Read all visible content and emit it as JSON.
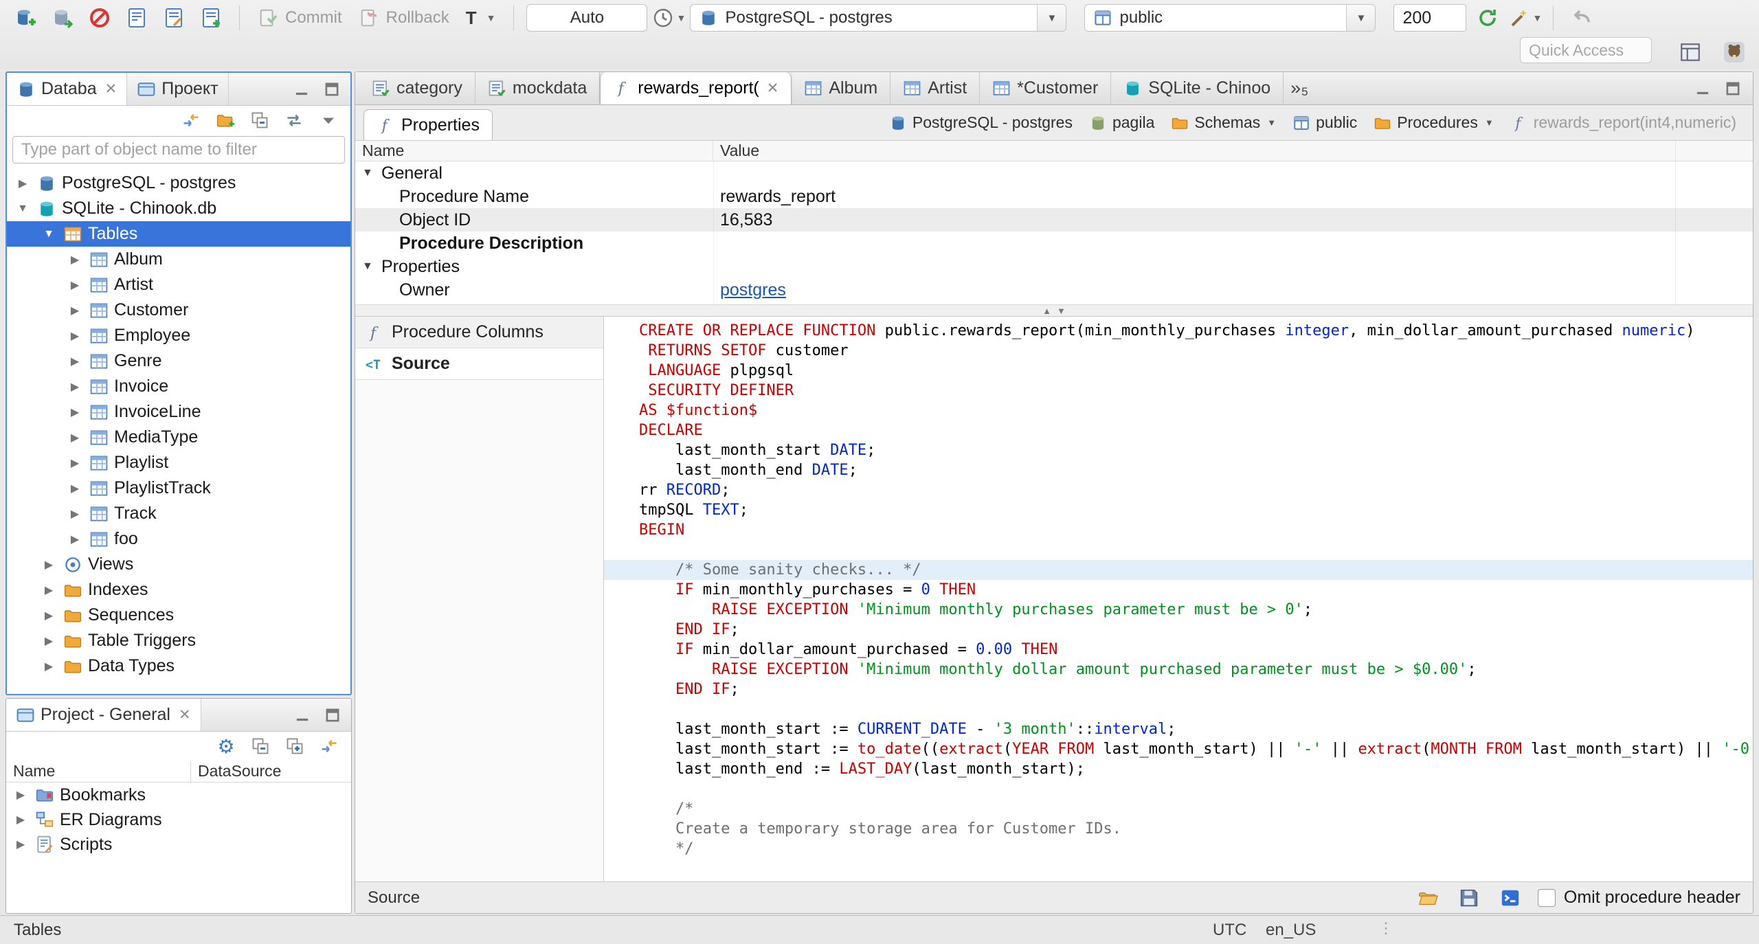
{
  "colors": {
    "selection_blue": "#3874d9",
    "focus_border": "#4f8fdb",
    "syntax_keyword": "#c80000",
    "syntax_type": "#0026d0",
    "syntax_string": "#00911f",
    "syntax_comment": "#6f6f6f",
    "link_blue": "#1a56b0"
  },
  "toolbar": {
    "commit_label": "Commit",
    "rollback_label": "Rollback",
    "txn_mode_label": "T",
    "auto_label": "Auto",
    "connection_value": "PostgreSQL - postgres",
    "schema_value": "public",
    "fetch_size": "200",
    "quick_access_placeholder": "Quick Access"
  },
  "navigator": {
    "tabs": [
      {
        "label": "Databa"
      },
      {
        "label": "Проект"
      }
    ],
    "filter_placeholder": "Type part of object name to filter",
    "tree": [
      {
        "label": "PostgreSQL - postgres",
        "icon": "postgres-icon",
        "level": 0,
        "state": "collapsed"
      },
      {
        "label": "SQLite - Chinook.db",
        "icon": "sqlite-icon",
        "level": 0,
        "state": "expanded"
      },
      {
        "label": "Tables",
        "icon": "tables-icon",
        "level": 1,
        "state": "expanded",
        "selected": true
      },
      {
        "label": "Album",
        "icon": "table-icon",
        "level": 2,
        "state": "collapsed"
      },
      {
        "label": "Artist",
        "icon": "table-icon",
        "level": 2,
        "state": "collapsed"
      },
      {
        "label": "Customer",
        "icon": "table-icon",
        "level": 2,
        "state": "collapsed"
      },
      {
        "label": "Employee",
        "icon": "table-icon",
        "level": 2,
        "state": "collapsed"
      },
      {
        "label": "Genre",
        "icon": "table-icon",
        "level": 2,
        "state": "collapsed"
      },
      {
        "label": "Invoice",
        "icon": "table-icon",
        "level": 2,
        "state": "collapsed"
      },
      {
        "label": "InvoiceLine",
        "icon": "table-icon",
        "level": 2,
        "state": "collapsed"
      },
      {
        "label": "MediaType",
        "icon": "table-icon",
        "level": 2,
        "state": "collapsed"
      },
      {
        "label": "Playlist",
        "icon": "table-icon",
        "level": 2,
        "state": "collapsed"
      },
      {
        "label": "PlaylistTrack",
        "icon": "table-icon",
        "level": 2,
        "state": "collapsed"
      },
      {
        "label": "Track",
        "icon": "table-icon",
        "level": 2,
        "state": "collapsed"
      },
      {
        "label": "foo",
        "icon": "table-icon",
        "level": 2,
        "state": "collapsed"
      },
      {
        "label": "Views",
        "icon": "views-icon",
        "level": 1,
        "state": "collapsed"
      },
      {
        "label": "Indexes",
        "icon": "folder-icon",
        "level": 1,
        "state": "collapsed"
      },
      {
        "label": "Sequences",
        "icon": "folder-icon",
        "level": 1,
        "state": "collapsed"
      },
      {
        "label": "Table Triggers",
        "icon": "folder-icon",
        "level": 1,
        "state": "collapsed"
      },
      {
        "label": "Data Types",
        "icon": "folder-icon",
        "level": 1,
        "state": "collapsed"
      }
    ]
  },
  "project_panel": {
    "tab_label": "Project - General",
    "columns": [
      "Name",
      "DataSource"
    ],
    "items": [
      {
        "label": "Bookmarks",
        "icon": "bookmarks-icon"
      },
      {
        "label": "ER Diagrams",
        "icon": "er-diagram-icon"
      },
      {
        "label": "Scripts",
        "icon": "scripts-icon"
      }
    ]
  },
  "editor_tabs": [
    {
      "label": "category",
      "icon": "script-icon"
    },
    {
      "label": "mockdata",
      "icon": "script-icon"
    },
    {
      "label": "rewards_report(",
      "icon": "function-icon",
      "active": true,
      "closable": true
    },
    {
      "label": "Album",
      "icon": "table-icon"
    },
    {
      "label": "Artist",
      "icon": "table-icon"
    },
    {
      "label": "*Customer",
      "icon": "table-icon"
    },
    {
      "label": "SQLite - Chinoo",
      "icon": "sqlite-icon"
    }
  ],
  "tab_overflow_count": "5",
  "properties_view": {
    "tab_label": "Properties",
    "columns": [
      "Name",
      "Value"
    ],
    "breadcrumb": [
      {
        "label": "PostgreSQL - postgres",
        "icon": "postgres-icon"
      },
      {
        "label": "pagila",
        "icon": "database-icon"
      },
      {
        "label": "Schemas",
        "icon": "folder-icon",
        "dropdown": true
      },
      {
        "label": "public",
        "icon": "schema-icon"
      },
      {
        "label": "Procedures",
        "icon": "folder-icon",
        "dropdown": true
      },
      {
        "label": "rewards_report(int4,numeric)",
        "icon": "function-icon",
        "muted": true
      }
    ],
    "rows": [
      {
        "type": "group",
        "name": "General"
      },
      {
        "type": "prop",
        "name": "Procedure Name",
        "value": "rewards_report"
      },
      {
        "type": "prop",
        "name": "Object ID",
        "value": "16,583",
        "shaded": true
      },
      {
        "type": "prop",
        "name": "Procedure Description",
        "value": "",
        "bold": true
      },
      {
        "type": "group",
        "name": "Properties"
      },
      {
        "type": "prop",
        "name": "Owner",
        "value": "postgres",
        "link": true
      }
    ]
  },
  "source_view": {
    "tabs": [
      {
        "label": "Procedure Columns",
        "icon": "function-icon"
      },
      {
        "label": "Source",
        "icon": "source-icon",
        "active": true
      }
    ],
    "bottom_label": "Source",
    "omit_label": "Omit procedure header",
    "code_lines": [
      {
        "h": false,
        "seg": [
          [
            "k",
            "CREATE OR REPLACE FUNCTION "
          ],
          [
            "p",
            "public.rewards_report(min_monthly_purchases "
          ],
          [
            "t",
            "integer"
          ],
          [
            "p",
            ", min_dollar_amount_purchased "
          ],
          [
            "t",
            "numeric"
          ],
          [
            "p",
            ")"
          ]
        ]
      },
      {
        "h": false,
        "seg": [
          [
            "p",
            " "
          ],
          [
            "k",
            "RETURNS SETOF"
          ],
          [
            "p",
            " customer"
          ]
        ]
      },
      {
        "h": false,
        "seg": [
          [
            "p",
            " "
          ],
          [
            "k",
            "LANGUAGE"
          ],
          [
            "p",
            " plpgsql"
          ]
        ]
      },
      {
        "h": false,
        "seg": [
          [
            "p",
            " "
          ],
          [
            "k",
            "SECURITY DEFINER"
          ]
        ]
      },
      {
        "h": false,
        "seg": [
          [
            "k",
            "AS"
          ],
          [
            "p",
            " "
          ],
          [
            "k",
            "$function$"
          ]
        ]
      },
      {
        "h": false,
        "seg": [
          [
            "k",
            "DECLARE"
          ]
        ]
      },
      {
        "h": false,
        "seg": [
          [
            "p",
            "    last_month_start "
          ],
          [
            "t",
            "DATE"
          ],
          [
            "p",
            ";"
          ]
        ]
      },
      {
        "h": false,
        "seg": [
          [
            "p",
            "    last_month_end "
          ],
          [
            "t",
            "DATE"
          ],
          [
            "p",
            ";"
          ]
        ]
      },
      {
        "h": false,
        "seg": [
          [
            "p",
            "rr "
          ],
          [
            "t",
            "RECORD"
          ],
          [
            "p",
            ";"
          ]
        ]
      },
      {
        "h": false,
        "seg": [
          [
            "p",
            "tmpSQL "
          ],
          [
            "t",
            "TEXT"
          ],
          [
            "p",
            ";"
          ]
        ]
      },
      {
        "h": false,
        "seg": [
          [
            "k",
            "BEGIN"
          ]
        ]
      },
      {
        "h": false,
        "seg": []
      },
      {
        "h": true,
        "seg": [
          [
            "p",
            "    "
          ],
          [
            "c",
            "/* Some sanity checks... */"
          ]
        ]
      },
      {
        "h": false,
        "seg": [
          [
            "p",
            "    "
          ],
          [
            "k",
            "IF"
          ],
          [
            "p",
            " min_monthly_purchases = "
          ],
          [
            "n",
            "0"
          ],
          [
            "p",
            " "
          ],
          [
            "k",
            "THEN"
          ]
        ]
      },
      {
        "h": false,
        "seg": [
          [
            "p",
            "        "
          ],
          [
            "k",
            "RAISE EXCEPTION"
          ],
          [
            "p",
            " "
          ],
          [
            "s",
            "'Minimum monthly purchases parameter must be > 0'"
          ],
          [
            "p",
            ";"
          ]
        ]
      },
      {
        "h": false,
        "seg": [
          [
            "p",
            "    "
          ],
          [
            "k",
            "END IF"
          ],
          [
            "p",
            ";"
          ]
        ]
      },
      {
        "h": false,
        "seg": [
          [
            "p",
            "    "
          ],
          [
            "k",
            "IF"
          ],
          [
            "p",
            " min_dollar_amount_purchased = "
          ],
          [
            "n",
            "0.00"
          ],
          [
            "p",
            " "
          ],
          [
            "k",
            "THEN"
          ]
        ]
      },
      {
        "h": false,
        "seg": [
          [
            "p",
            "        "
          ],
          [
            "k",
            "RAISE EXCEPTION"
          ],
          [
            "p",
            " "
          ],
          [
            "s",
            "'Minimum monthly dollar amount purchased parameter must be > $0.00'"
          ],
          [
            "p",
            ";"
          ]
        ]
      },
      {
        "h": false,
        "seg": [
          [
            "p",
            "    "
          ],
          [
            "k",
            "END IF"
          ],
          [
            "p",
            ";"
          ]
        ]
      },
      {
        "h": false,
        "seg": []
      },
      {
        "h": false,
        "seg": [
          [
            "p",
            "    last_month_start := "
          ],
          [
            "t",
            "CURRENT_DATE"
          ],
          [
            "p",
            " - "
          ],
          [
            "s",
            "'3 month'"
          ],
          [
            "p",
            "::"
          ],
          [
            "t",
            "interval"
          ],
          [
            "p",
            ";"
          ]
        ]
      },
      {
        "h": false,
        "seg": [
          [
            "p",
            "    last_month_start := "
          ],
          [
            "k",
            "to_date"
          ],
          [
            "p",
            "(("
          ],
          [
            "k",
            "extract"
          ],
          [
            "p",
            "("
          ],
          [
            "k",
            "YEAR FROM"
          ],
          [
            "p",
            " last_month_start) || "
          ],
          [
            "s",
            "'-'"
          ],
          [
            "p",
            " || "
          ],
          [
            "k",
            "extract"
          ],
          [
            "p",
            "("
          ],
          [
            "k",
            "MONTH FROM"
          ],
          [
            "p",
            " last_month_start) || "
          ],
          [
            "s",
            "'-0"
          ]
        ]
      },
      {
        "h": false,
        "seg": [
          [
            "p",
            "    last_month_end := "
          ],
          [
            "k",
            "LAST_DAY"
          ],
          [
            "p",
            "(last_month_start);"
          ]
        ]
      },
      {
        "h": false,
        "seg": []
      },
      {
        "h": false,
        "seg": [
          [
            "p",
            "    "
          ],
          [
            "c",
            "/*"
          ]
        ]
      },
      {
        "h": false,
        "seg": [
          [
            "p",
            "    "
          ],
          [
            "c",
            "Create a temporary storage area for Customer IDs."
          ]
        ]
      },
      {
        "h": false,
        "seg": [
          [
            "p",
            "    "
          ],
          [
            "c",
            "*/"
          ]
        ]
      }
    ]
  },
  "status_bar": {
    "left": "Tables",
    "timezone": "UTC",
    "locale": "en_US"
  }
}
